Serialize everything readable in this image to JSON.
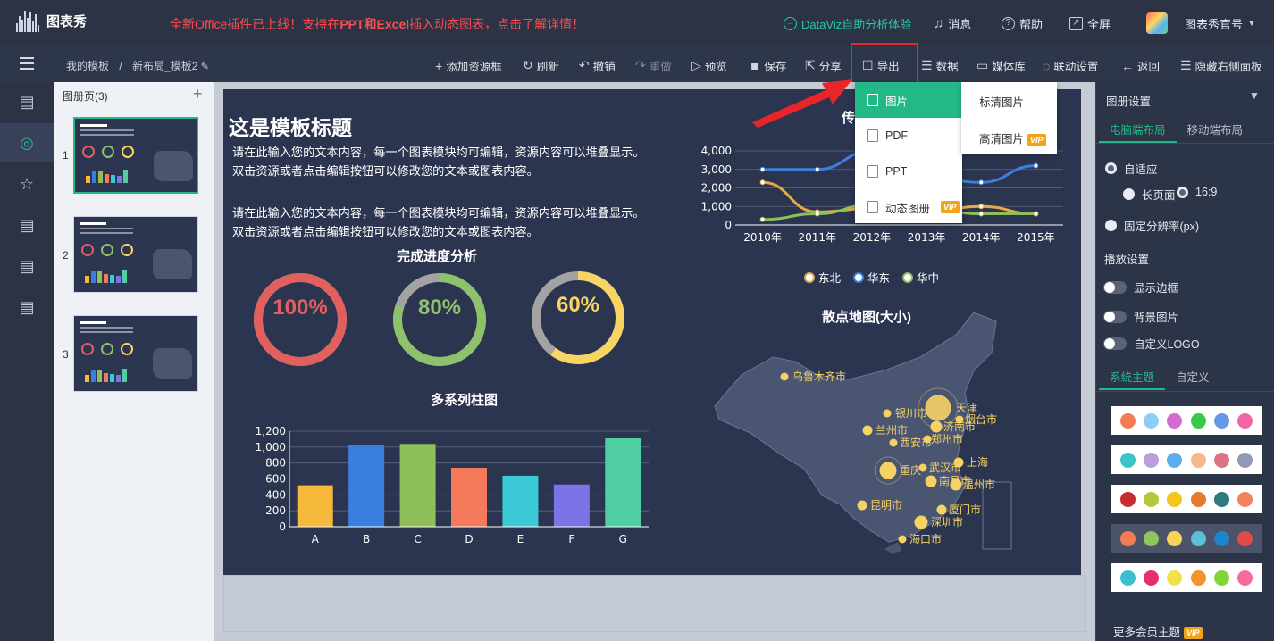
{
  "header": {
    "logo_text": "图表秀",
    "promo_prefix": "全新Office插件已上线！支持在",
    "promo_bold": "PPT和Excel",
    "promo_suffix": "插入动态图表，点击了解详情！",
    "dataviz": "DataViz自助分析体验",
    "messages": "消息",
    "help": "帮助",
    "fullscreen": "全屏",
    "account": "图表秀官号"
  },
  "toolbar": {
    "breadcrumb_root": "我的模板",
    "breadcrumb_sep": "/",
    "breadcrumb_current": "新布局_模板2",
    "add_resource": "添加资源框",
    "refresh": "刷新",
    "undo": "撤销",
    "redo": "重做",
    "preview": "预览",
    "save": "保存",
    "share": "分享",
    "export": "导出",
    "data": "数据",
    "media": "媒体库",
    "link_settings": "联动设置",
    "back": "返回",
    "hide_right": "隐藏右侧面板"
  },
  "pages": {
    "header": "图册页(3)",
    "items": [
      "1",
      "2",
      "3"
    ]
  },
  "slide": {
    "title": "这是模板标题",
    "para1": "请在此输入您的文本内容，每一个图表模块均可编辑，资源内容可以堆叠显示。双击资源或者点击编辑按钮可以修改您的文本或图表内容。",
    "para2": "请在此输入您的文本内容，每一个图表模块均可编辑，资源内容可以堆叠显示。双击资源或者点击编辑按钮可以修改您的文本或图表内容。",
    "progress_title": "完成进度分析",
    "bar_title": "多系列柱图",
    "line_title_partial": "传",
    "map_title": "散点地图(大小)"
  },
  "chart_data": [
    {
      "type": "donut",
      "title": "完成进度分析",
      "values": [
        100,
        80,
        60
      ],
      "labels": [
        "100%",
        "80%",
        "60%"
      ],
      "colors": [
        "#e0605e",
        "#8dc16b",
        "#f7d464"
      ]
    },
    {
      "type": "bar",
      "title": "多系列柱图",
      "categories": [
        "A",
        "B",
        "C",
        "D",
        "E",
        "F",
        "G"
      ],
      "values": [
        520,
        1030,
        1040,
        740,
        640,
        530,
        1110
      ],
      "colors": [
        "#f6b93b",
        "#3a7fe0",
        "#8fbf5a",
        "#f5795b",
        "#3cc9d6",
        "#7c73e6",
        "#4fcfa3"
      ],
      "ylim": [
        0,
        1200
      ],
      "yticks": [
        "0",
        "200",
        "400",
        "600",
        "800",
        "1,000",
        "1,200"
      ]
    },
    {
      "type": "line",
      "categories": [
        "2010年",
        "2011年",
        "2012年",
        "2013年",
        "2014年",
        "2015年"
      ],
      "ylim": [
        0,
        4000
      ],
      "yticks": [
        "0",
        "1,000",
        "2,000",
        "3,000",
        "4,000"
      ],
      "series": [
        {
          "name": "东北",
          "color": "#e6a94a",
          "values": [
            2300,
            700,
            900,
            700,
            1000,
            600
          ]
        },
        {
          "name": "华东",
          "color": "#3f7fdc",
          "values": [
            3000,
            3000,
            4000,
            2600,
            2300,
            3200
          ]
        },
        {
          "name": "华中",
          "color": "#8fbf5a",
          "values": [
            300,
            600,
            1100,
            900,
            600,
            600
          ]
        }
      ]
    },
    {
      "type": "scatter-map",
      "title": "散点地图(大小)",
      "cities": [
        "乌鲁木齐市",
        "银川市",
        "天津",
        "烟台市",
        "兰州市",
        "济南市",
        "西安市",
        "郑州市",
        "上海",
        "重庆",
        "武汉市",
        "南昌市",
        "温州市",
        "昆明市",
        "厦门市",
        "深圳市",
        "海口市"
      ]
    }
  ],
  "export_menu": {
    "items": [
      "图片",
      "PDF",
      "PPT",
      "动态图册"
    ],
    "vip": "VIP",
    "image_sub": [
      "标清图片",
      "高清图片"
    ]
  },
  "right_panel": {
    "header": "图册设置",
    "layout_tabs": [
      "电脑端布局",
      "移动端布局"
    ],
    "adaptive": "自适应",
    "long_page": "长页面",
    "ratio": "16:9",
    "fixed": "固定分辨率(px)",
    "playback": "播放设置",
    "toggles": [
      "显示边框",
      "背景图片",
      "自定义LOGO"
    ],
    "theme_tabs": [
      "系统主题",
      "自定义"
    ],
    "more_themes": "更多会员主题",
    "themes": [
      [
        "#f47c54",
        "#8ecdf5",
        "#d66ad3",
        "#37c94a",
        "#6597e8",
        "#f266a8"
      ],
      [
        "#3bc4c6",
        "#b9a0dd",
        "#5ab0ea",
        "#f6b88b",
        "#dc7484",
        "#8f9bb4"
      ],
      [
        "#c62f2f",
        "#b8c63c",
        "#f6c41c",
        "#e67a2d",
        "#2f7a7f",
        "#f2835f"
      ],
      [
        "#f47c54",
        "#8ec65b",
        "#f7d35a",
        "#5ac0d9",
        "#1f84c9",
        "#e34a4a"
      ],
      [
        "#3dbdd4",
        "#e7306b",
        "#f4e04a",
        "#f3932b",
        "#82d43a",
        "#f56ba0"
      ]
    ]
  }
}
